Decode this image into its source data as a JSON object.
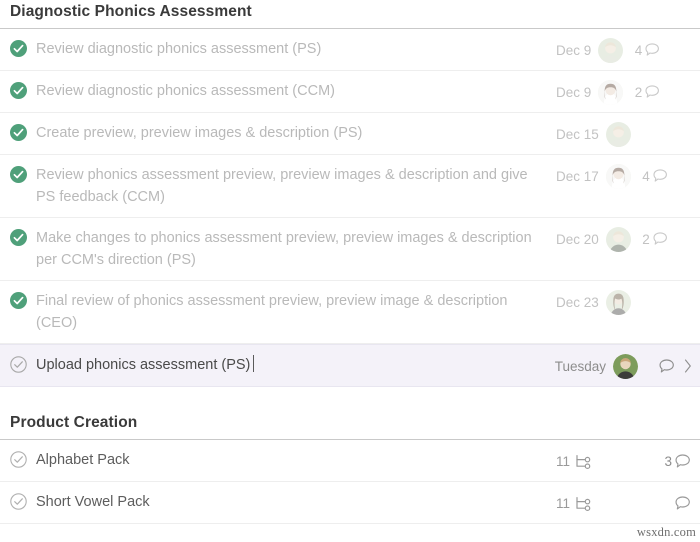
{
  "sections": [
    {
      "title": "Diagnostic Phonics Assessment",
      "tasks": [
        {
          "name": "Review diagnostic phonics assessment (PS)",
          "state": "complete",
          "date": "Dec 9",
          "avatar": "avatar-green-blonde",
          "comments": "4",
          "selected": false
        },
        {
          "name": "Review diagnostic phonics assessment (CCM)",
          "state": "complete",
          "date": "Dec 9",
          "avatar": "avatar-white-brunette",
          "comments": "2",
          "selected": false
        },
        {
          "name": "Create preview, preview images & description (PS)",
          "state": "complete",
          "date": "Dec 15",
          "avatar": "avatar-green-blonde",
          "comments": "",
          "selected": false
        },
        {
          "name": "Review phonics assessment preview, preview images & description and give PS feedback (CCM)",
          "state": "complete",
          "date": "Dec 17",
          "avatar": "avatar-white-brunette",
          "comments": "4",
          "selected": false
        },
        {
          "name": "Make changes to phonics assessment preview, preview images & description per CCM's direction (PS)",
          "state": "complete",
          "date": "Dec 20",
          "avatar": "avatar-green-blonde",
          "comments": "2",
          "selected": false
        },
        {
          "name": "Final review of phonics assessment preview, preview image & description (CEO)",
          "state": "complete",
          "date": "Dec 23",
          "avatar": "avatar-green-long-hair",
          "comments": "",
          "selected": false
        },
        {
          "name": "Upload phonics assessment (PS)",
          "state": "open",
          "date": "Tuesday",
          "avatar": "avatar-green-blonde",
          "comments": "",
          "selected": true
        }
      ]
    },
    {
      "title": "Product Creation",
      "tasks": [
        {
          "name": "Alphabet Pack",
          "state": "open",
          "subtasks": "11",
          "comments": "3",
          "selected": false
        },
        {
          "name": "Short Vowel Pack",
          "state": "open",
          "subtasks": "11",
          "comments": "",
          "selected": false
        }
      ]
    }
  ],
  "icons": {
    "check_complete": "check-circle-filled-icon",
    "check_open": "check-circle-outline-icon",
    "comment": "comment-bubble-icon",
    "subtask": "subtask-branch-icon",
    "chevron": "chevron-right-icon"
  },
  "colors": {
    "complete_green": "#4fa07a",
    "selected_row": "#f4f2f9",
    "muted_text": "#b9b9b9",
    "header_text": "#3a3a3a"
  },
  "watermark": "wsxdn.com"
}
